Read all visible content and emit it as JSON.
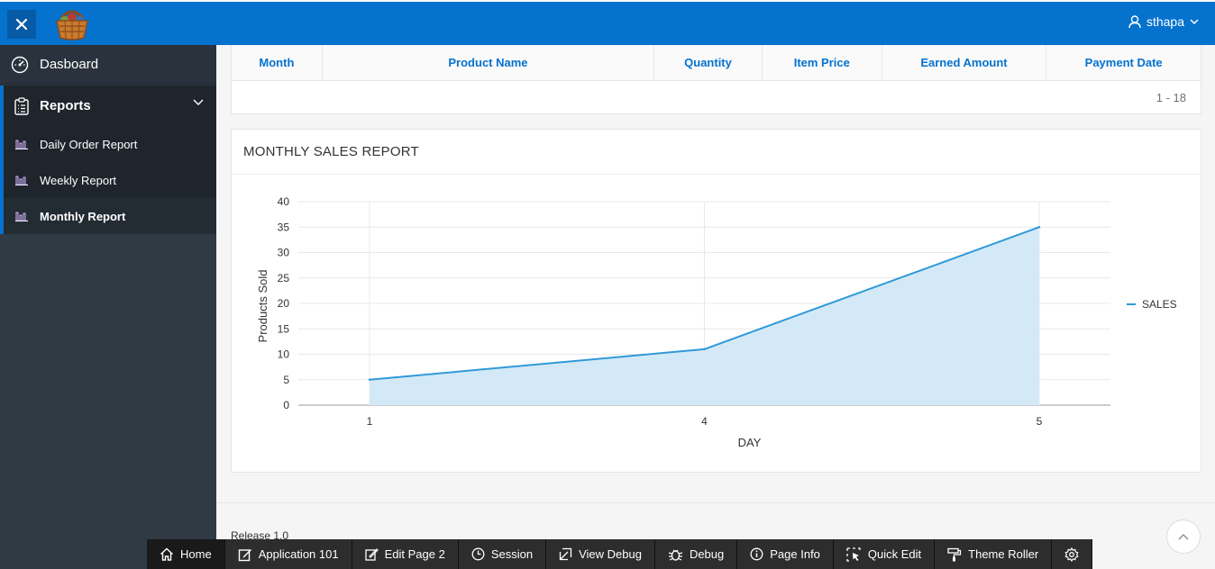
{
  "header": {
    "username": "sthapa",
    "brand_color": "#0572ce"
  },
  "sidebar": {
    "items": [
      {
        "label": "Dasboard",
        "icon": "speedometer-icon"
      },
      {
        "label": "Reports",
        "icon": "clipboard-icon",
        "expanded": true
      },
      {
        "label": "Daily Order Report",
        "icon": "bar-chart-icon"
      },
      {
        "label": "Weekly Report",
        "icon": "bar-chart-icon"
      },
      {
        "label": "Monthly Report",
        "icon": "bar-chart-icon",
        "active": true
      }
    ]
  },
  "report": {
    "columns": [
      "Month",
      "Product Name",
      "Quantity",
      "Item Price",
      "Earned Amount",
      "Payment Date"
    ],
    "pagination": "1 - 18"
  },
  "chart_region": {
    "title": "MONTHLY SALES REPORT"
  },
  "chart_data": {
    "type": "area",
    "title": "",
    "xlabel": "DAY",
    "ylabel": "Products Sold",
    "categories": [
      "1",
      "4",
      "5"
    ],
    "series": [
      {
        "name": "SALES",
        "values": [
          5,
          11,
          35
        ],
        "color": "#2f9ad8"
      }
    ],
    "ylim": [
      0,
      40
    ],
    "yticks": [
      0,
      5,
      10,
      15,
      20,
      25,
      30,
      35,
      40
    ],
    "grid": true,
    "legend_position": "right"
  },
  "footer": {
    "release": "Release 1.0"
  },
  "devbar": {
    "items": [
      {
        "label": "Home",
        "icon": "home-icon"
      },
      {
        "label": "Application 101",
        "icon": "edit-icon"
      },
      {
        "label": "Edit Page 2",
        "icon": "pencil-icon"
      },
      {
        "label": "Session",
        "icon": "clock-icon"
      },
      {
        "label": "View Debug",
        "icon": "view-debug-icon"
      },
      {
        "label": "Debug",
        "icon": "bug-icon"
      },
      {
        "label": "Page Info",
        "icon": "info-icon"
      },
      {
        "label": "Quick Edit",
        "icon": "cursor-select-icon"
      },
      {
        "label": "Theme Roller",
        "icon": "paint-roller-icon"
      },
      {
        "label": "",
        "icon": "gear-icon"
      }
    ]
  }
}
